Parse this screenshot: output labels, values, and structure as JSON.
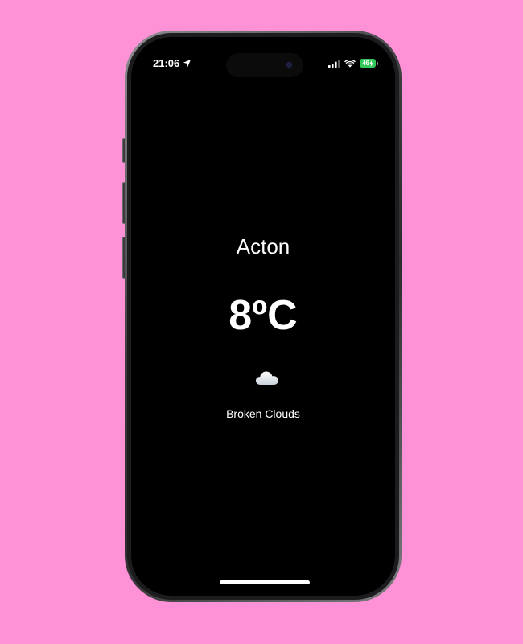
{
  "background_color": "#ff91d6",
  "status_bar": {
    "time": "21:06",
    "location_icon": "location-arrow-icon",
    "signal_icon": "cellular-signal-icon",
    "wifi_icon": "wifi-icon",
    "battery_level": "46",
    "battery_color": "#34c759",
    "charging_icon": "bolt-icon"
  },
  "weather": {
    "city": "Acton",
    "temperature": "8ºC",
    "condition_icon": "cloud-icon",
    "description": "Broken Clouds"
  }
}
